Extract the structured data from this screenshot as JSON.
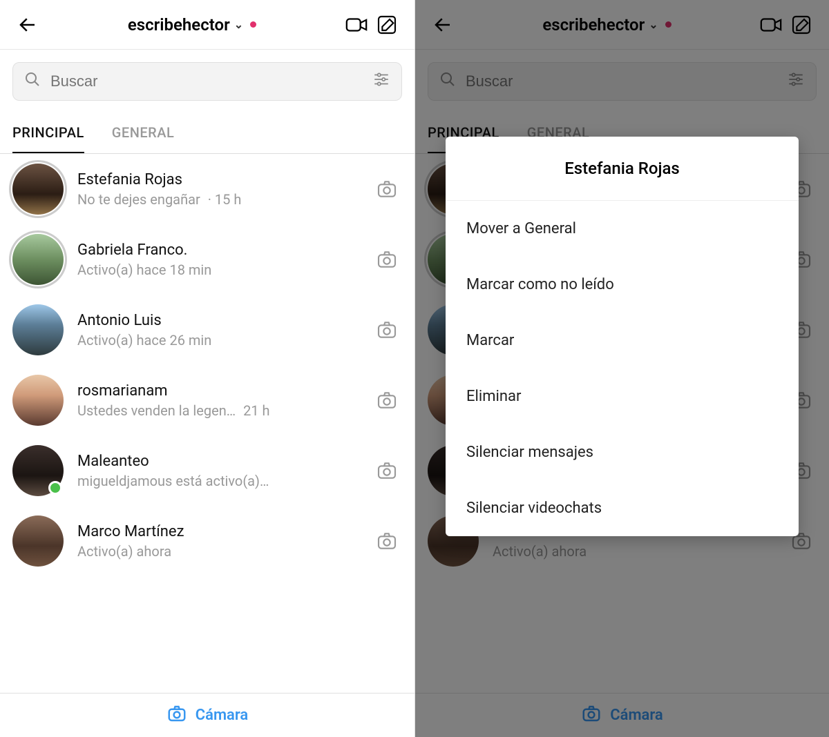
{
  "header": {
    "username": "escribehector"
  },
  "search": {
    "placeholder": "Buscar"
  },
  "tabs": {
    "principal": "PRINCIPAL",
    "general": "GENERAL"
  },
  "chats": [
    {
      "name": "Estefania Rojas",
      "sub": "No te dejes engañar",
      "time": "· 15 h",
      "avatar": "av1",
      "story": true
    },
    {
      "name": "Gabriela Franco.",
      "sub": "Activo(a) hace 18 min",
      "time": "",
      "avatar": "av2",
      "story": true
    },
    {
      "name": "Antonio Luis",
      "sub": "Activo(a) hace 26 min",
      "time": "",
      "avatar": "av3",
      "story": false
    },
    {
      "name": "rosmarianam",
      "sub": "Ustedes venden la legen…",
      "time": "21 h",
      "avatar": "av4",
      "story": false
    },
    {
      "name": "Maleanteo",
      "sub": "migueldjamous está activo(a)…",
      "time": "",
      "avatar": "av5",
      "story": false,
      "presence": true
    },
    {
      "name": "Marco Martínez",
      "sub": "Activo(a) ahora",
      "time": "",
      "avatar": "av6",
      "story": false,
      "gradient": true
    }
  ],
  "footer": {
    "camera": "Cámara"
  },
  "menu": {
    "title": "Estefania Rojas",
    "items": [
      "Mover a General",
      "Marcar como no leído",
      "Marcar",
      "Eliminar",
      "Silenciar mensajes",
      "Silenciar videochats"
    ]
  }
}
